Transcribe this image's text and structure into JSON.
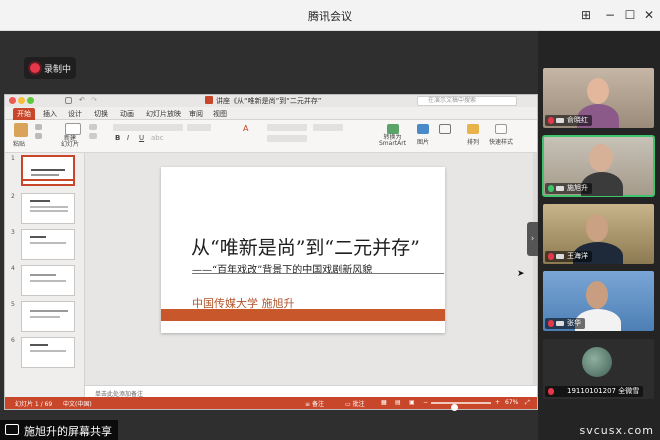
{
  "window": {
    "title": "腾讯会议"
  },
  "meeting": {
    "recording_label": "录制中",
    "share_label": "施旭升的屏幕共享",
    "participants": [
      {
        "name": "俞晓红",
        "mic": "muted"
      },
      {
        "name": "施旭升",
        "mic": "on"
      },
      {
        "name": "王海洋",
        "mic": "muted"
      },
      {
        "name": "张华",
        "mic": "muted"
      },
      {
        "name": "19110101207 全微雪",
        "mic": "muted"
      }
    ]
  },
  "ppt": {
    "doc_title": "讲座《从“唯新是尚”到“二元并存”",
    "search_placeholder": "在演示文稿中搜索",
    "tabs": [
      "开始",
      "插入",
      "设计",
      "切换",
      "动画",
      "幻灯片放映",
      "审阅",
      "视图"
    ],
    "ribbon": {
      "paste": "粘贴",
      "new_slide": "新建\n幻灯片",
      "convert_smartart": "转换为\nSmartArt",
      "picture": "图片",
      "arrange": "排列",
      "quick_styles": "快速样式"
    },
    "slide": {
      "title": "从“唯新是尚”到“二元并存”",
      "subtitle": "——“百年戏改”背景下的中国戏剧新风貌",
      "author": "中国传媒大学   施旭升"
    },
    "thumb_numbers": [
      "1",
      "2",
      "3",
      "4",
      "5",
      "6"
    ],
    "notes_placeholder": "单击此处添加备注",
    "status": {
      "slide_counter": "幻灯片 1 / 69",
      "language": "中文(中国)",
      "notes": "备注",
      "comments": "批注",
      "zoom": "67%",
      "zoom_level": 0.67
    }
  },
  "colors": {
    "accent": "#c8462a",
    "record": "#e8374a",
    "active_speaker": "#3ec46d"
  },
  "watermark": "svcusx.com"
}
